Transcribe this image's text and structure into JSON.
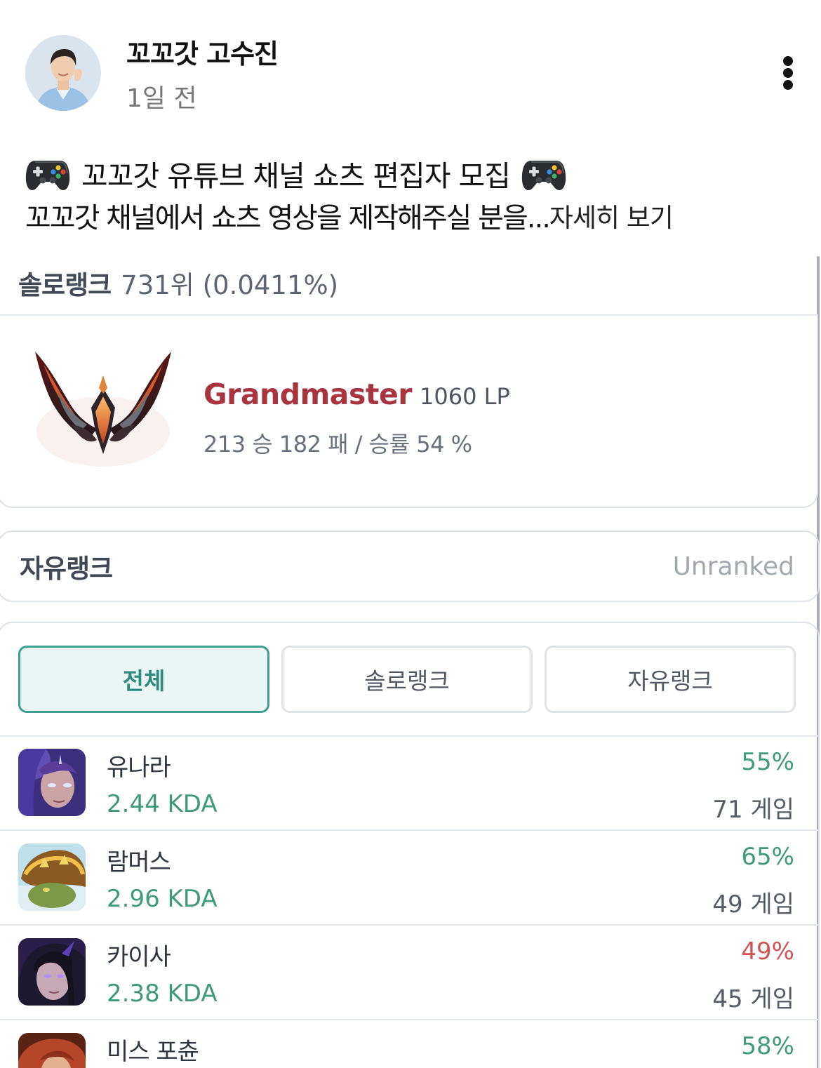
{
  "post": {
    "author_name": "꼬꼬갓 고수진",
    "time": "1일 전",
    "title_text": "꼬꼬갓 유튜브 채널 쇼츠 편집자 모집",
    "icon": "game-controller-emoji",
    "body_preview": "꼬꼬갓 채널에서 쇼츠 영상을 제작해주실 분을...",
    "see_more": "자세히 보기"
  },
  "solo_rank": {
    "label": "솔로랭크",
    "ranking": "731위 (0.0411%)",
    "tier": "Grandmaster",
    "lp": "1060 LP",
    "record": "213 승 182 패 / 승률 54 %",
    "tier_color": "#a8343f"
  },
  "flex_rank": {
    "label": "자유랭크",
    "status": "Unranked"
  },
  "filters": [
    "전체",
    "솔로랭크",
    "자유랭크"
  ],
  "active_filter": "전체",
  "champions": [
    {
      "name": "유나라",
      "kda": "2.44 KDA",
      "winrate": "55%",
      "games": "71 게임"
    },
    {
      "name": "람머스",
      "kda": "2.96 KDA",
      "winrate": "65%",
      "games": "49 게임"
    },
    {
      "name": "카이사",
      "kda": "2.38 KDA",
      "winrate": "49%",
      "games": "45 게임"
    },
    {
      "name": "미스 포츈",
      "kda": "",
      "winrate": "58%",
      "games": ""
    }
  ],
  "colors": {
    "accent": "#3c9e90",
    "winrate_good": "#3e9a79",
    "winrate_bad": "#d05252"
  }
}
